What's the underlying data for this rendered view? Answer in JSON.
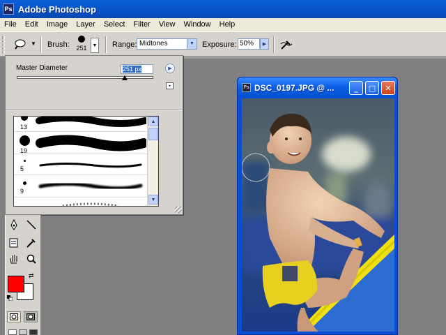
{
  "app": {
    "title": "Adobe Photoshop",
    "logo_text": "Ps"
  },
  "menu": [
    "File",
    "Edit",
    "Image",
    "Layer",
    "Select",
    "Filter",
    "View",
    "Window",
    "Help"
  ],
  "options": {
    "brush_label": "Brush:",
    "brush_size": "251",
    "range_label": "Range:",
    "range_value": "Midtones",
    "exposure_label": "Exposure:",
    "exposure_value": "50%"
  },
  "brush_picker": {
    "master_diameter_label": "Master Diameter",
    "master_diameter_value": "251 px",
    "slider_value": 0.79,
    "brushes": [
      {
        "size": "13"
      },
      {
        "size": "19"
      },
      {
        "size": "5"
      },
      {
        "size": "9"
      }
    ]
  },
  "colors": {
    "foreground": "#ff0000",
    "background": "#ffffff",
    "title_bar": "#0a5fd8"
  },
  "document": {
    "title": "DSC_0197.JPG @ ..."
  },
  "icons": [
    "dodge-tool-icon",
    "airbrush-icon",
    "pen-tool-icon",
    "line-tool-icon",
    "notes-tool-icon",
    "eyedropper-icon",
    "hand-tool-icon",
    "zoom-tool-icon",
    "minimize-icon",
    "maximize-icon",
    "close-icon"
  ]
}
